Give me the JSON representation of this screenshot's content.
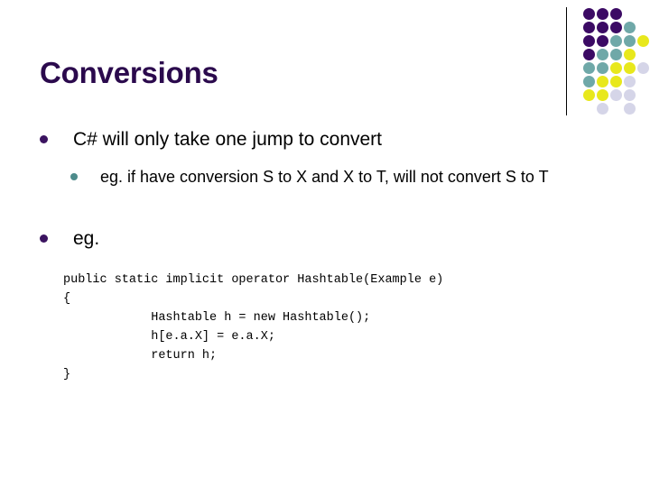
{
  "slide": {
    "title": "Conversions",
    "title_color": "#2b0a4d",
    "background_color": "#ffffff",
    "text_color": "#000000"
  },
  "bullets": {
    "level1_marker_color": "#3b1360",
    "level2_marker_color": "#4d8b8b",
    "items": [
      {
        "level": 1,
        "text": "C# will only take one jump to convert"
      },
      {
        "level": 2,
        "text": "eg. if have conversion S to X and X to T, will not convert S to T"
      },
      {
        "level": 1,
        "text": "eg."
      }
    ]
  },
  "code": {
    "lines": [
      "public static implicit operator Hashtable(Example e)",
      "{",
      "            Hashtable h = new Hashtable();",
      "            h[e.a.X] = e.a.X;",
      "            return h;",
      "}"
    ]
  },
  "decoration": {
    "rule_color": "#000000",
    "palette": {
      "purple": "#3b0a64",
      "teal": "#6fa8a8",
      "yellow": "#e8e81c",
      "lavender": "#d5d5e8"
    },
    "dot_rows": [
      [
        "purple",
        "purple",
        "purple",
        null,
        null
      ],
      [
        "purple",
        "purple",
        "purple",
        "teal",
        null
      ],
      [
        "purple",
        "purple",
        "teal",
        "teal",
        "yellow"
      ],
      [
        "purple",
        "teal",
        "teal",
        "yellow",
        null
      ],
      [
        "teal",
        "teal",
        "yellow",
        "yellow",
        "lavender"
      ],
      [
        "teal",
        "yellow",
        "yellow",
        "lavender",
        null
      ],
      [
        "yellow",
        "yellow",
        "lavender",
        "lavender",
        null
      ],
      [
        null,
        "lavender",
        null,
        "lavender",
        null
      ]
    ]
  }
}
